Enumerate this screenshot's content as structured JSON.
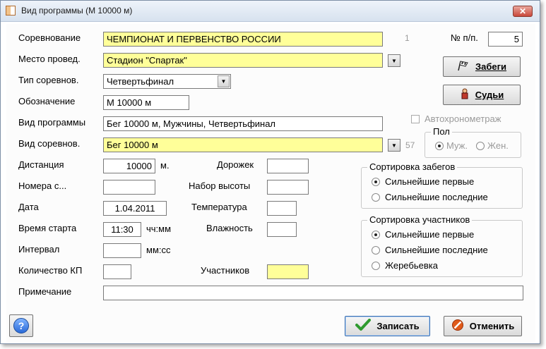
{
  "window": {
    "title": "Вид программы  (М 10000 м)",
    "close_label": "✕"
  },
  "form": {
    "competition_label": "Соревнование",
    "competition_value": "ЧЕМПИОНАТ И ПЕРВЕНСТВО РОССИИ",
    "competition_hint": "1",
    "number_label": "№ п/п.",
    "number_value": "5",
    "venue_label": "Место провед.",
    "venue_value": "Стадион \"Спартак\"",
    "comp_type_label": "Тип соревнов.",
    "comp_type_value": "Четвертьфинал",
    "designation_label": "Обозначение",
    "designation_value": "М 10000 м",
    "program_label": "Вид программы",
    "program_value": "Бег 10000 м, Мужчины, Четвертьфинал",
    "event_label": "Вид соревнов.",
    "event_value": "Бег 10000 м",
    "event_hint": "57",
    "distance_label": "Дистанция",
    "distance_value": "10000",
    "distance_unit": "м.",
    "numbers_label": "Номера с...",
    "numbers_value": "",
    "date_label": "Дата",
    "date_value": "1.04.2011",
    "start_time_label": "Время старта",
    "start_time_value": "11:30",
    "start_time_unit": "чч:мм",
    "interval_label": "Интервал",
    "interval_value": "",
    "interval_unit": "мм:сс",
    "kp_count_label": "Количество КП",
    "kp_count_value": "",
    "note_label": "Примечание",
    "note_value": "",
    "lanes_label": "Дорожек",
    "lanes_value": "",
    "height_label": "Набор высоты",
    "height_value": "",
    "temperature_label": "Температура",
    "temperature_value": "",
    "humidity_label": "Влажность",
    "humidity_value": "",
    "participants_label": "Участников",
    "participants_value": ""
  },
  "right": {
    "heats_button": "Забеги",
    "judges_button": "Судьи",
    "autotiming_label": "Автохронометраж",
    "gender_title": "Пол",
    "gender_male": "Муж.",
    "gender_female": "Жен."
  },
  "heat_sort": {
    "title": "Сортировка забегов",
    "options": [
      "Сильнейшие первые",
      "Сильнейшие последние"
    ]
  },
  "participant_sort": {
    "title": "Сортировка участников",
    "options": [
      "Сильнейшие первые",
      "Сильнейшие последние",
      "Жеребьевка"
    ]
  },
  "footer": {
    "help_label": "?",
    "save_button": "Записать",
    "cancel_button": "Отменить"
  },
  "colors": {
    "highlight": "#ffff99",
    "window_border": "#7d8fa6"
  }
}
